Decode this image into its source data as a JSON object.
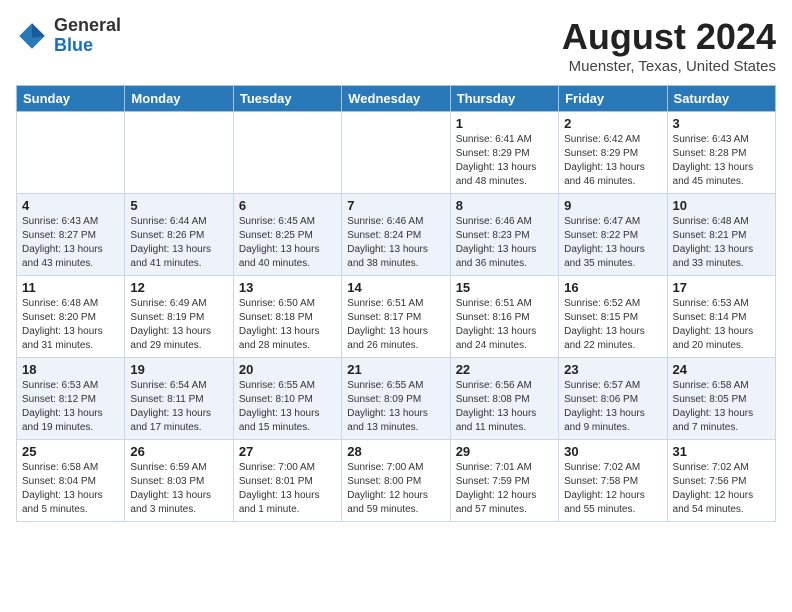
{
  "header": {
    "logo_general": "General",
    "logo_blue": "Blue",
    "month_title": "August 2024",
    "location": "Muenster, Texas, United States"
  },
  "weekdays": [
    "Sunday",
    "Monday",
    "Tuesday",
    "Wednesday",
    "Thursday",
    "Friday",
    "Saturday"
  ],
  "weeks": [
    [
      {
        "day": "",
        "info": ""
      },
      {
        "day": "",
        "info": ""
      },
      {
        "day": "",
        "info": ""
      },
      {
        "day": "",
        "info": ""
      },
      {
        "day": "1",
        "info": "Sunrise: 6:41 AM\nSunset: 8:29 PM\nDaylight: 13 hours\nand 48 minutes."
      },
      {
        "day": "2",
        "info": "Sunrise: 6:42 AM\nSunset: 8:29 PM\nDaylight: 13 hours\nand 46 minutes."
      },
      {
        "day": "3",
        "info": "Sunrise: 6:43 AM\nSunset: 8:28 PM\nDaylight: 13 hours\nand 45 minutes."
      }
    ],
    [
      {
        "day": "4",
        "info": "Sunrise: 6:43 AM\nSunset: 8:27 PM\nDaylight: 13 hours\nand 43 minutes."
      },
      {
        "day": "5",
        "info": "Sunrise: 6:44 AM\nSunset: 8:26 PM\nDaylight: 13 hours\nand 41 minutes."
      },
      {
        "day": "6",
        "info": "Sunrise: 6:45 AM\nSunset: 8:25 PM\nDaylight: 13 hours\nand 40 minutes."
      },
      {
        "day": "7",
        "info": "Sunrise: 6:46 AM\nSunset: 8:24 PM\nDaylight: 13 hours\nand 38 minutes."
      },
      {
        "day": "8",
        "info": "Sunrise: 6:46 AM\nSunset: 8:23 PM\nDaylight: 13 hours\nand 36 minutes."
      },
      {
        "day": "9",
        "info": "Sunrise: 6:47 AM\nSunset: 8:22 PM\nDaylight: 13 hours\nand 35 minutes."
      },
      {
        "day": "10",
        "info": "Sunrise: 6:48 AM\nSunset: 8:21 PM\nDaylight: 13 hours\nand 33 minutes."
      }
    ],
    [
      {
        "day": "11",
        "info": "Sunrise: 6:48 AM\nSunset: 8:20 PM\nDaylight: 13 hours\nand 31 minutes."
      },
      {
        "day": "12",
        "info": "Sunrise: 6:49 AM\nSunset: 8:19 PM\nDaylight: 13 hours\nand 29 minutes."
      },
      {
        "day": "13",
        "info": "Sunrise: 6:50 AM\nSunset: 8:18 PM\nDaylight: 13 hours\nand 28 minutes."
      },
      {
        "day": "14",
        "info": "Sunrise: 6:51 AM\nSunset: 8:17 PM\nDaylight: 13 hours\nand 26 minutes."
      },
      {
        "day": "15",
        "info": "Sunrise: 6:51 AM\nSunset: 8:16 PM\nDaylight: 13 hours\nand 24 minutes."
      },
      {
        "day": "16",
        "info": "Sunrise: 6:52 AM\nSunset: 8:15 PM\nDaylight: 13 hours\nand 22 minutes."
      },
      {
        "day": "17",
        "info": "Sunrise: 6:53 AM\nSunset: 8:14 PM\nDaylight: 13 hours\nand 20 minutes."
      }
    ],
    [
      {
        "day": "18",
        "info": "Sunrise: 6:53 AM\nSunset: 8:12 PM\nDaylight: 13 hours\nand 19 minutes."
      },
      {
        "day": "19",
        "info": "Sunrise: 6:54 AM\nSunset: 8:11 PM\nDaylight: 13 hours\nand 17 minutes."
      },
      {
        "day": "20",
        "info": "Sunrise: 6:55 AM\nSunset: 8:10 PM\nDaylight: 13 hours\nand 15 minutes."
      },
      {
        "day": "21",
        "info": "Sunrise: 6:55 AM\nSunset: 8:09 PM\nDaylight: 13 hours\nand 13 minutes."
      },
      {
        "day": "22",
        "info": "Sunrise: 6:56 AM\nSunset: 8:08 PM\nDaylight: 13 hours\nand 11 minutes."
      },
      {
        "day": "23",
        "info": "Sunrise: 6:57 AM\nSunset: 8:06 PM\nDaylight: 13 hours\nand 9 minutes."
      },
      {
        "day": "24",
        "info": "Sunrise: 6:58 AM\nSunset: 8:05 PM\nDaylight: 13 hours\nand 7 minutes."
      }
    ],
    [
      {
        "day": "25",
        "info": "Sunrise: 6:58 AM\nSunset: 8:04 PM\nDaylight: 13 hours\nand 5 minutes."
      },
      {
        "day": "26",
        "info": "Sunrise: 6:59 AM\nSunset: 8:03 PM\nDaylight: 13 hours\nand 3 minutes."
      },
      {
        "day": "27",
        "info": "Sunrise: 7:00 AM\nSunset: 8:01 PM\nDaylight: 13 hours\nand 1 minute."
      },
      {
        "day": "28",
        "info": "Sunrise: 7:00 AM\nSunset: 8:00 PM\nDaylight: 12 hours\nand 59 minutes."
      },
      {
        "day": "29",
        "info": "Sunrise: 7:01 AM\nSunset: 7:59 PM\nDaylight: 12 hours\nand 57 minutes."
      },
      {
        "day": "30",
        "info": "Sunrise: 7:02 AM\nSunset: 7:58 PM\nDaylight: 12 hours\nand 55 minutes."
      },
      {
        "day": "31",
        "info": "Sunrise: 7:02 AM\nSunset: 7:56 PM\nDaylight: 12 hours\nand 54 minutes."
      }
    ]
  ]
}
